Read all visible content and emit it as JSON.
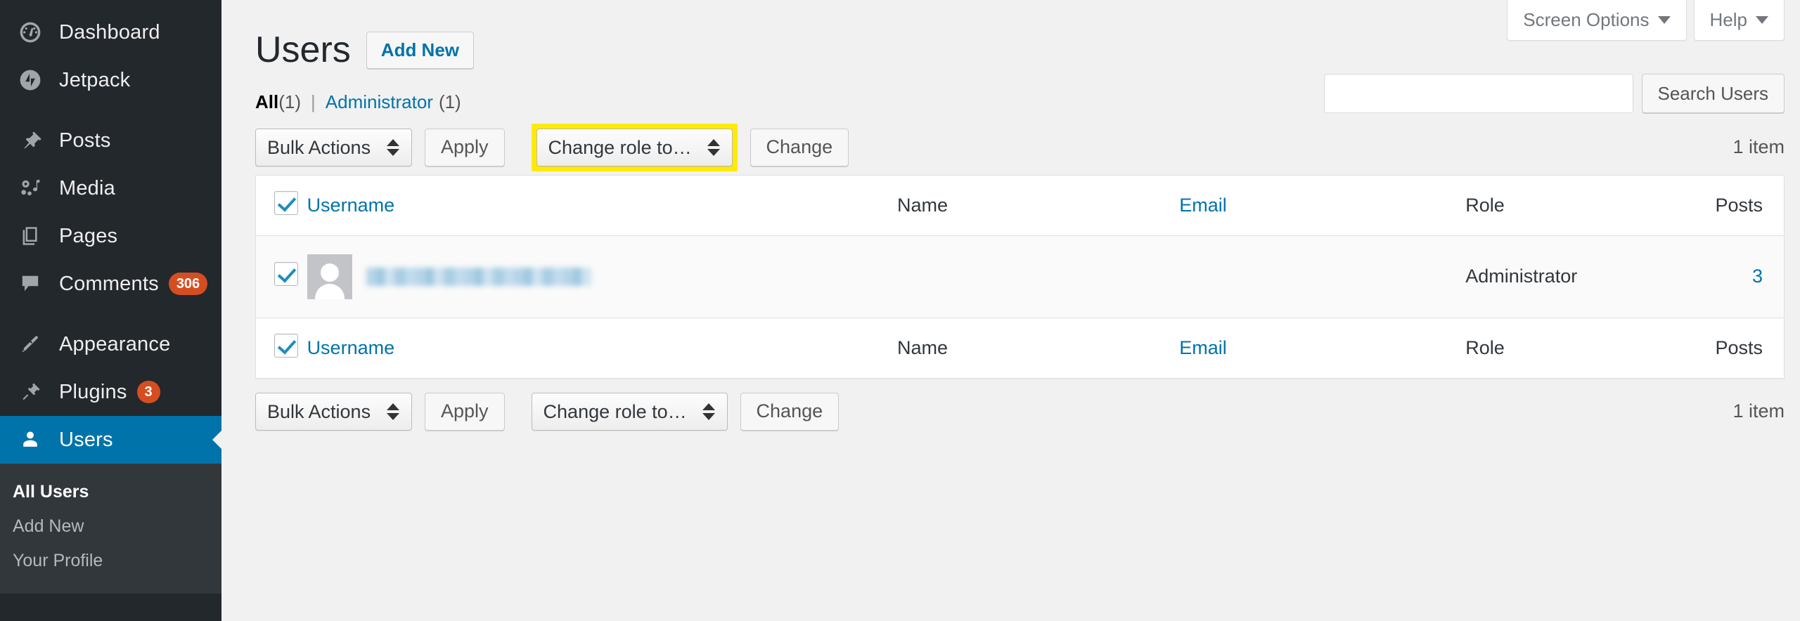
{
  "sidebar": {
    "items": [
      {
        "label": "Dashboard",
        "icon": "dashboard-icon",
        "badge": null,
        "active": false
      },
      {
        "label": "Jetpack",
        "icon": "jetpack-icon",
        "badge": null,
        "active": false
      },
      {
        "label": "Posts",
        "icon": "pin-icon",
        "badge": null,
        "active": false
      },
      {
        "label": "Media",
        "icon": "media-icon",
        "badge": null,
        "active": false
      },
      {
        "label": "Pages",
        "icon": "pages-icon",
        "badge": null,
        "active": false
      },
      {
        "label": "Comments",
        "icon": "comment-icon",
        "badge": "306",
        "active": false
      },
      {
        "label": "Appearance",
        "icon": "paintbrush-icon",
        "badge": null,
        "active": false
      },
      {
        "label": "Plugins",
        "icon": "plug-icon",
        "badge": "3",
        "active": false
      },
      {
        "label": "Users",
        "icon": "user-icon",
        "badge": null,
        "active": true
      }
    ],
    "submenu": [
      {
        "label": "All Users",
        "current": true
      },
      {
        "label": "Add New",
        "current": false
      },
      {
        "label": "Your Profile",
        "current": false
      }
    ]
  },
  "screen_meta": {
    "screen_options_label": "Screen Options",
    "help_label": "Help"
  },
  "header": {
    "title": "Users",
    "add_new_label": "Add New"
  },
  "filters": {
    "all_label": "All",
    "all_count": "(1)",
    "separator": "|",
    "administrator_label": "Administrator",
    "administrator_count": "(1)"
  },
  "search": {
    "value": "",
    "placeholder": "",
    "submit_label": "Search Users"
  },
  "tablenav_top": {
    "bulk_actions_label": "Bulk Actions",
    "apply_label": "Apply",
    "change_role_label": "Change role to…",
    "change_label": "Change",
    "displaying_num": "1 item",
    "change_role_highlighted": true,
    "highlight_color": "#ffeb00"
  },
  "tablenav_bottom": {
    "bulk_actions_label": "Bulk Actions",
    "apply_label": "Apply",
    "change_role_label": "Change role to…",
    "change_label": "Change",
    "displaying_num": "1 item",
    "change_role_highlighted": false
  },
  "table": {
    "columns": [
      "Username",
      "Name",
      "Email",
      "Role",
      "Posts"
    ],
    "rows": [
      {
        "username": "",
        "name": "",
        "email": "",
        "role": "Administrator",
        "posts": "3",
        "checked": true,
        "redacted": true
      }
    ]
  },
  "colors": {
    "accent": "#0073aa",
    "sidebar_bg": "#23282d",
    "submenu_bg": "#32373c",
    "badge": "#d54e21",
    "highlight": "#ffeb00",
    "page_bg": "#f1f1f1"
  }
}
